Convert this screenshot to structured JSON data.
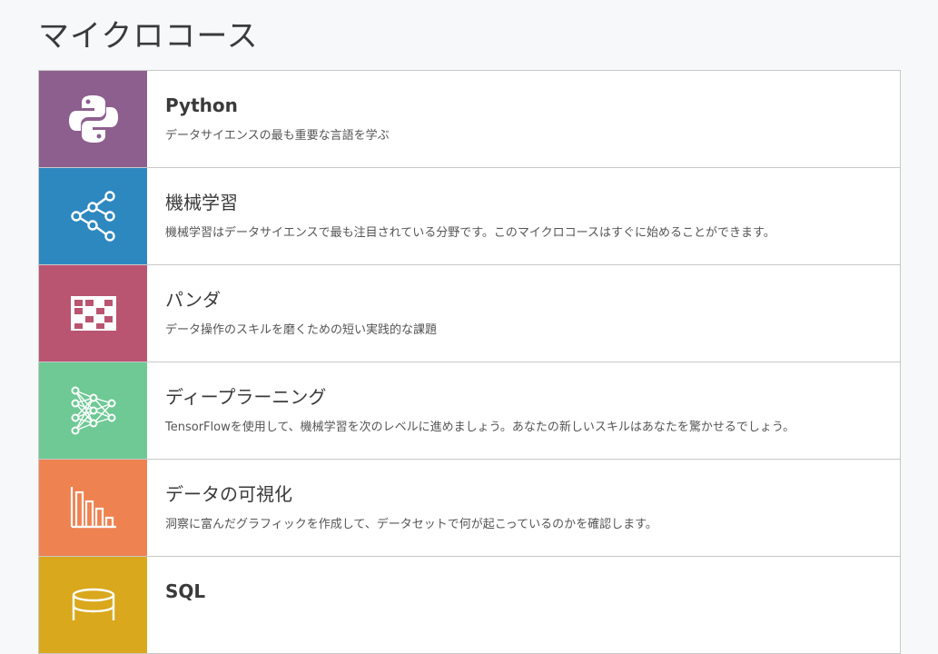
{
  "page": {
    "title": "マイクロコース"
  },
  "courses": [
    {
      "title": "Python",
      "bold": true,
      "description": "データサイエンスの最も重要な言語を学ぶ",
      "color": "#8d5f8e",
      "icon": "python-icon"
    },
    {
      "title": "機械学習",
      "bold": false,
      "description": "機械学習はデータサイエンスで最も注目されている分野です。このマイクロコースはすぐに始めることができます。",
      "color": "#2e88c0",
      "icon": "network-graph-icon"
    },
    {
      "title": "パンダ",
      "bold": false,
      "description": "データ操作のスキルを磨くための短い実践的な課題",
      "color": "#b95571",
      "icon": "dataframe-grid-icon"
    },
    {
      "title": "ディープラーニング",
      "bold": false,
      "description": "TensorFlowを使用して、機械学習を次のレベルに進めましょう。あなたの新しいスキルはあなたを驚かせるでしょう。",
      "color": "#6ec994",
      "icon": "neural-network-icon"
    },
    {
      "title": "データの可視化",
      "bold": false,
      "description": "洞察に富んだグラフィックを作成して、データセットで何が起こっているのかを確認します。",
      "color": "#ef8251",
      "icon": "bar-chart-icon"
    },
    {
      "title": "SQL",
      "bold": true,
      "description": "",
      "color": "#d9a81c",
      "icon": "database-icon"
    }
  ]
}
